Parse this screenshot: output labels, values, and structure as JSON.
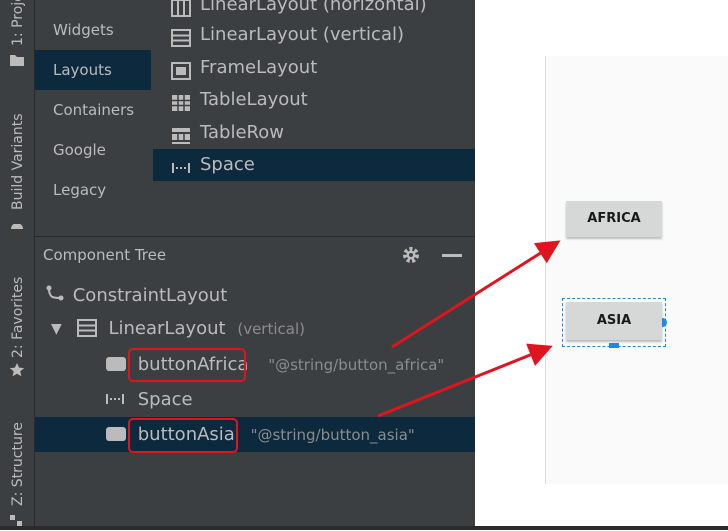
{
  "left_stripe": {
    "project_tab": "1: Project",
    "build_variants_tab": "Build Variants",
    "favorites_tab": "2: Favorites",
    "structure_tab": "Z: Structure"
  },
  "palette": {
    "categories": [
      "Widgets",
      "Layouts",
      "Containers",
      "Google",
      "Legacy"
    ],
    "selected_category": "Layouts",
    "items": [
      "LinearLayout (horizontal)",
      "LinearLayout (vertical)",
      "FrameLayout",
      "TableLayout",
      "TableRow",
      "Space"
    ],
    "selected_item": "Space"
  },
  "component_tree": {
    "title": "Component Tree",
    "root": "ConstraintLayout",
    "linear": {
      "label": "LinearLayout",
      "hint": "(vertical)"
    },
    "button_africa": {
      "id": "buttonAfrica",
      "text": "\"@string/button_africa\""
    },
    "space": "Space",
    "button_asia": {
      "id": "buttonAsia",
      "text": "\"@string/button_asia\""
    }
  },
  "preview": {
    "africa_button": "AFRICA",
    "asia_button": "ASIA"
  },
  "colors": {
    "panel_bg": "#3c3f41",
    "selection": "#0d293e",
    "annotation_red": "#e0141e",
    "selection_handle": "#1e88e5"
  }
}
